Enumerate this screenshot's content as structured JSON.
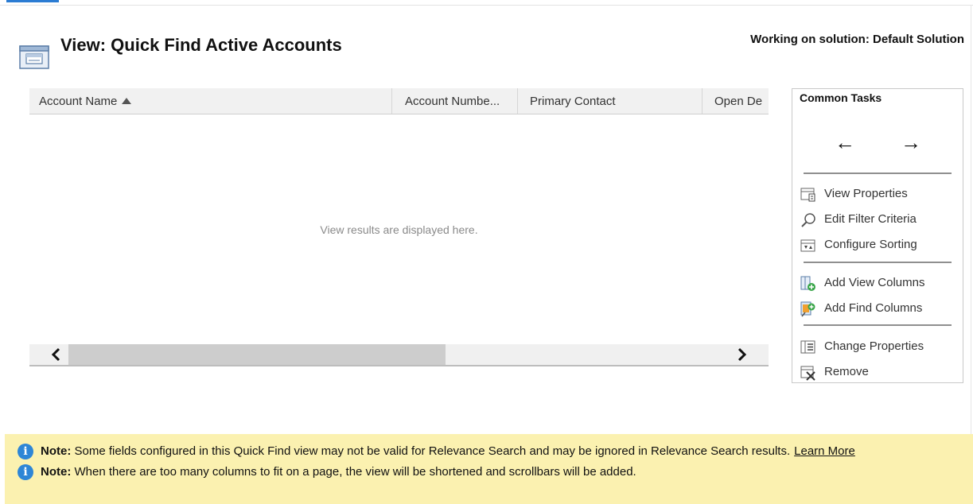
{
  "header": {
    "title": "View: Quick Find Active Accounts",
    "solution": "Working on solution: Default Solution"
  },
  "grid": {
    "columns": [
      "Account Name",
      "Account Numbe...",
      "Primary Contact",
      "Open De"
    ],
    "sorted_column": "Account Name",
    "sort_direction": "ascending",
    "empty_message": "View results are displayed here."
  },
  "common_tasks": {
    "title": "Common Tasks",
    "back_glyph": "←",
    "forward_glyph": "→",
    "items": [
      {
        "label": "View Properties",
        "icon": "view-properties-icon"
      },
      {
        "label": "Edit Filter Criteria",
        "icon": "magnifier-icon"
      },
      {
        "label": "Configure Sorting",
        "icon": "sorting-icon"
      },
      {
        "label": "Add View Columns",
        "icon": "add-view-columns-icon"
      },
      {
        "label": "Add Find Columns",
        "icon": "add-find-columns-icon"
      },
      {
        "label": "Change Properties",
        "icon": "change-properties-icon"
      },
      {
        "label": "Remove",
        "icon": "remove-icon"
      }
    ]
  },
  "notes": {
    "label": "Note:",
    "note1": "Some fields configured in this Quick Find view may not be valid for Relevance Search and may be ignored in Relevance Search results.",
    "learn_more": "Learn More",
    "note2": "When there are too many columns to fit on a page, the view will be shortened and scrollbars will be added."
  },
  "colors": {
    "note_background": "#fbf1b0",
    "info_icon": "#2e86d6",
    "accent": "#2b7cd3"
  }
}
